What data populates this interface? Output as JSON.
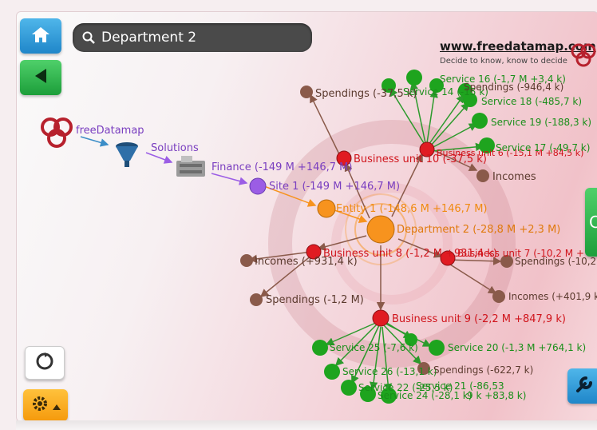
{
  "search": {
    "value": "Department 2"
  },
  "site": {
    "url": "www.freedatamap.com",
    "tagline": "Decide to know, know to decide"
  },
  "right_tab": {
    "label": "C"
  },
  "logo": {
    "label": "freeDatamap"
  },
  "flow": {
    "solutions": "Solutions",
    "finance": "Finance (-149 M +146,7 M)"
  },
  "nodes": {
    "site1": "Site 1 (-149 M +146,7 M)",
    "entity1": "Entity 1 (-148,6 M +146,7 M)",
    "department2": "Department 2 (-28,8 M +2,3 M)",
    "bu10": "Business unit 10 (-37,5 k)",
    "bu6": "Business unit 6 (-15,1 M +84,5 k)",
    "bu8": "Business unit 8 (-1,2 M +931,4 k)",
    "bu7": "Business unit 7 (-10,2 M +",
    "bu9": "Business unit 9 (-2,2 M +847,9 k)",
    "spendings_top": "Spendings (-37,5 k)",
    "incomes_right": "Incomes",
    "incomes_left": "Incomes (+931,4 k)",
    "spendings_left": "Spendings (-1,2 M)",
    "spendings_bu7": "Spendings (-10,2 M",
    "incomes_bu7": "Incomes (+401,9 k)",
    "s16": "Service 16 (-1,7 M +3,4 k)",
    "s14": "Service 14 (-15 k)",
    "s_sp": "Spendings (-946,4 k)",
    "s18": "Service 18 (-485,7 k)",
    "s19": "Service 19 (-188,3 k)",
    "s17": "Service 17 (-49,7 k)",
    "s25": "Service 25 (-7,6 k)",
    "s20": "Service 20 (-1,3 M +764,1 k)",
    "s26": "Service 26 (-13,1 k)",
    "s_sp2": "Spendings (-622,7 k)",
    "s22": "Service 22 (-25,5 k)",
    "s21": "Service 21 (-86,53",
    "s24": "Service 24 (-28,1 k)",
    "s23": "9 k +83,8 k)"
  },
  "colors": {
    "central": "#f7931e",
    "business": "#e01b22",
    "service": "#1ea41e",
    "brown": "#7a4a3a",
    "site": "#9b5de5"
  }
}
